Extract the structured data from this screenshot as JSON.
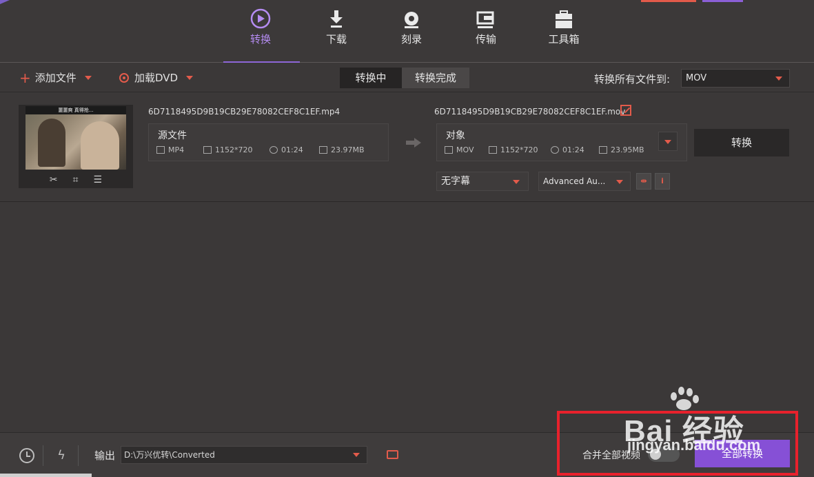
{
  "nav": {
    "items": [
      {
        "label": "转换",
        "icon": "convert-play-icon",
        "active": true
      },
      {
        "label": "下载",
        "icon": "download-arrow-icon",
        "active": false
      },
      {
        "label": "刻录",
        "icon": "burn-disc-icon",
        "active": false
      },
      {
        "label": "传输",
        "icon": "transfer-device-icon",
        "active": false
      },
      {
        "label": "工具箱",
        "icon": "toolbox-icon",
        "active": false
      }
    ]
  },
  "toolbar": {
    "add_file": "添加文件",
    "load_dvd": "加载DVD",
    "tab_converting": "转换中",
    "tab_done": "转换完成",
    "convert_all_to_label": "转换所有文件到:",
    "target_format": "MOV"
  },
  "file": {
    "thumbnail_caption": "噩噩爽 真得抢...",
    "source_name": "6D7118495D9B19CB29E78082CEF8C1EF.mp4",
    "target_name": "6D7118495D9B19CB29E78082CEF8C1EF.mov",
    "source": {
      "title": "源文件",
      "format": "MP4",
      "resolution": "1152*720",
      "duration": "01:24",
      "size": "23.97MB"
    },
    "target": {
      "title": "对象",
      "format": "MOV",
      "resolution": "1152*720",
      "duration": "01:24",
      "size": "23.95MB"
    },
    "convert_button": "转换",
    "subtitle_select": "无字幕",
    "audio_select": "Advanced Au..."
  },
  "footer": {
    "output_label": "输出",
    "output_path": "D:\\万兴优转\\Converted",
    "merge_label": "合并全部视频",
    "convert_all_button": "全部转换"
  },
  "watermark": {
    "brand": "Bai  经验",
    "site": "jingyan.baidu.com"
  },
  "colors": {
    "accent_purple": "#8650d6",
    "accent_red": "#e35b4b",
    "annotation_red": "#e8212c"
  }
}
